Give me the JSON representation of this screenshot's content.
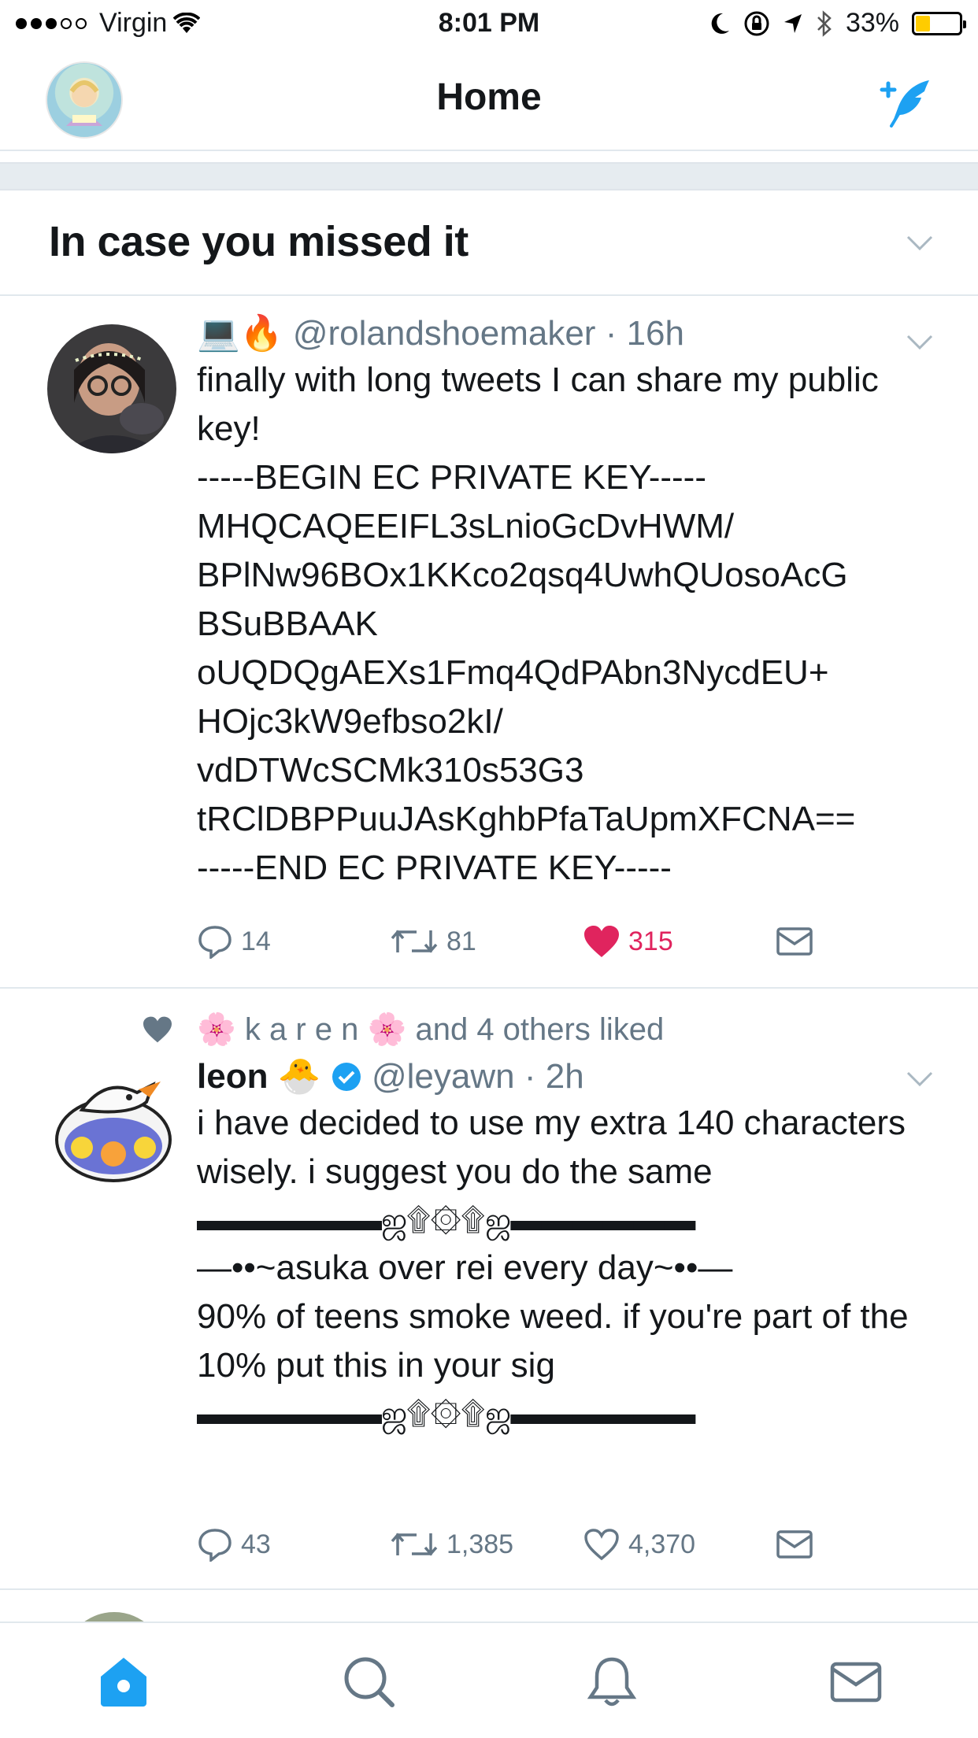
{
  "status_bar": {
    "carrier": "Virgin",
    "time": "8:01 PM",
    "battery": "33%",
    "battery_level": 0.33
  },
  "nav": {
    "title": "Home",
    "avatar_icon": "profile-avatar",
    "compose_icon": "compose-tweet-icon"
  },
  "section": {
    "title": "In case you missed it"
  },
  "tweets": [
    {
      "emoji_prefix": "💻🔥",
      "handle": "@rolandshoemaker",
      "time": "16h",
      "text": "finally with long tweets I can share my public key!\n-----BEGIN EC PRIVATE KEY-----\nMHQCAQEEIFL3sLnioGcDvHWM/\nBPlNw96BOx1KKco2qsq4UwhQUosoAcG\nBSuBBAAK\noUQDQgAEXs1Fmq4QdPAbn3NycdEU+\nHOjc3kW9efbso2kI/\nvdDTWcSCMk310s53G3\ntRClDBPPuuJAsKghbPfaTaUpmXFCNA==\n-----END EC PRIVATE KEY-----",
      "replies": "14",
      "retweets": "81",
      "likes": "315",
      "liked": true
    },
    {
      "social_context": "🌸 k a r e n 🌸 and 4 others liked",
      "name": "leon",
      "name_emoji": "🐣",
      "verified": true,
      "handle": "@leyawn",
      "time": "2h",
      "text": "i have decided to use my extra 140 characters wisely. i suggest you do the same",
      "divider": "▬▬▬▬▬▬ஜ۩۞۩ஜ▬▬▬▬▬▬",
      "text2": "—••~asuka over rei every day~••—\n90% of teens smoke weed. if you're part of the 10% put this in your sig",
      "divider2": "▬▬▬▬▬▬ஜ۩۞۩ஜ▬▬▬▬▬▬",
      "replies": "43",
      "retweets": "1,385",
      "likes": "4,370",
      "liked": false
    }
  ],
  "tabs": [
    "home",
    "search",
    "notifications",
    "messages"
  ],
  "colors": {
    "twitter_blue": "#1da1f2",
    "like_red": "#e0245e",
    "gray": "#657786",
    "separator": "#e1e8ed"
  }
}
